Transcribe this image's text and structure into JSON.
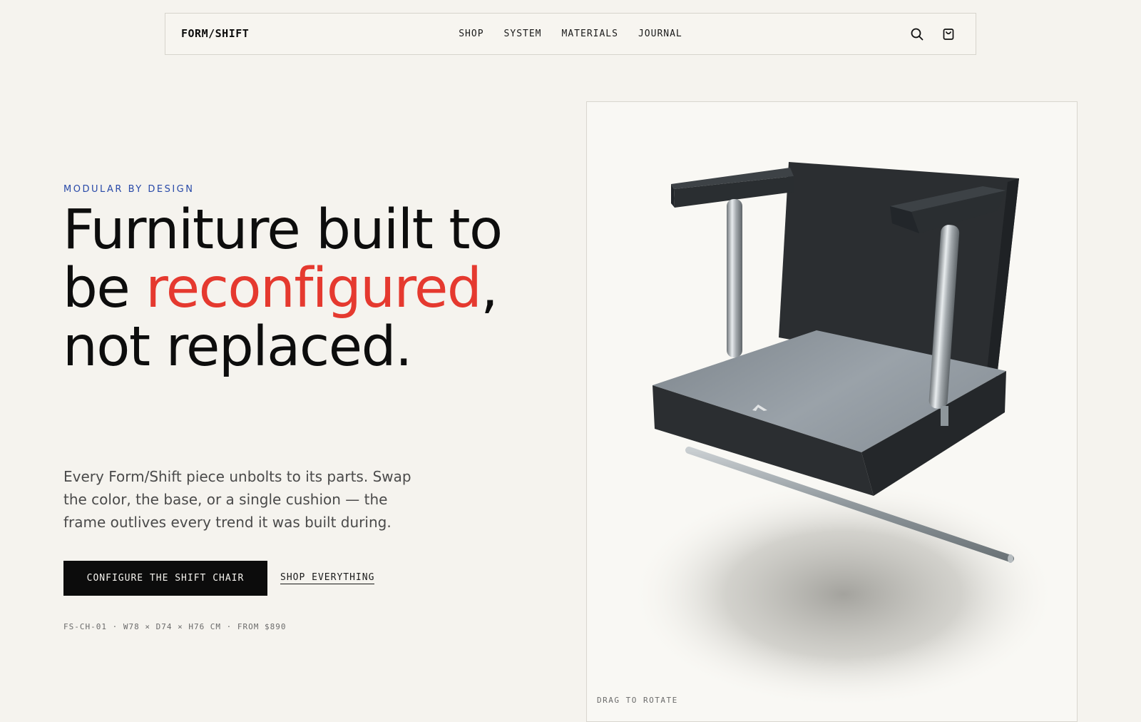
{
  "brand": {
    "logo": "FORM/SHIFT"
  },
  "nav": {
    "links": [
      "SHOP",
      "SYSTEM",
      "MATERIALS",
      "JOURNAL"
    ],
    "icons": [
      "search-icon",
      "cart-icon"
    ]
  },
  "hero": {
    "eyebrow": "MODULAR BY DESIGN",
    "headline_part1": "Furniture built to be",
    "headline_accent": "reconfigured",
    "headline_part2": ", not replaced.",
    "lede": "Every Form/Shift piece unbolts to its parts. Swap the color, the base, or a single cushion — the frame outlives every trend it was built during.",
    "primary_cta": "CONFIGURE THE SHIFT CHAIR",
    "secondary_cta": "SHOP EVERYTHING",
    "specs": "FS-CH-01 · W78 × D74 × H76 CM · FROM $890"
  },
  "viewer": {
    "hint": "DRAG TO ROTATE"
  },
  "colors": {
    "background": "#f5f3ee",
    "accent": "#e5392f",
    "eyebrow": "#2849a8",
    "ink": "#0c0c0c"
  }
}
